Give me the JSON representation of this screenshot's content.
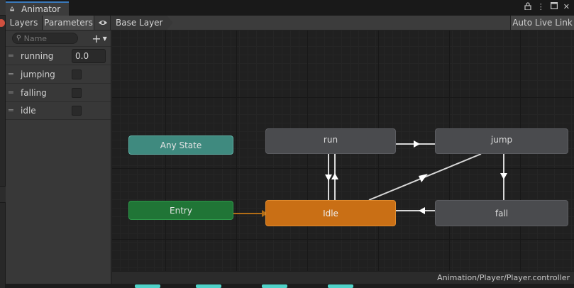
{
  "window": {
    "tab_title": "Animator",
    "tab_icon": "animator-icon",
    "controls": [
      "lock-icon",
      "menu-icon",
      "maximize-icon",
      "close-icon"
    ]
  },
  "toolbar": {
    "layers_label": "Layers",
    "parameters_label": "Parameters",
    "eye_icon": "eye-icon",
    "breadcrumb": "Base Layer",
    "live_link_label": "Auto Live Link"
  },
  "parameters": {
    "search_placeholder": "Name",
    "add_icon": "plus-icon",
    "items": [
      {
        "name": "running",
        "type": "float",
        "value": "0.0"
      },
      {
        "name": "jumping",
        "type": "bool",
        "value": false
      },
      {
        "name": "falling",
        "type": "bool",
        "value": false
      },
      {
        "name": "idle",
        "type": "bool",
        "value": false
      }
    ]
  },
  "graph": {
    "nodes": {
      "any_state": "Any State",
      "entry": "Entry",
      "run": "run",
      "jump": "jump",
      "idle": "Idle",
      "fall": "fall"
    },
    "colors": {
      "any_state": "#3f8a7f",
      "entry": "#207536",
      "state": "#4a4b4e",
      "default_state": "#c96f15",
      "transition": "#d8d8d8",
      "default_transition": "#b26d16"
    },
    "transitions": [
      {
        "from": "Entry",
        "to": "Idle"
      },
      {
        "from": "run",
        "to": "jump"
      },
      {
        "from": "run",
        "to": "Idle"
      },
      {
        "from": "Idle",
        "to": "run"
      },
      {
        "from": "Idle",
        "to": "jump"
      },
      {
        "from": "jump",
        "to": "fall"
      },
      {
        "from": "fall",
        "to": "Idle"
      }
    ]
  },
  "status": {
    "path": "Animation/Player/Player.controller"
  }
}
